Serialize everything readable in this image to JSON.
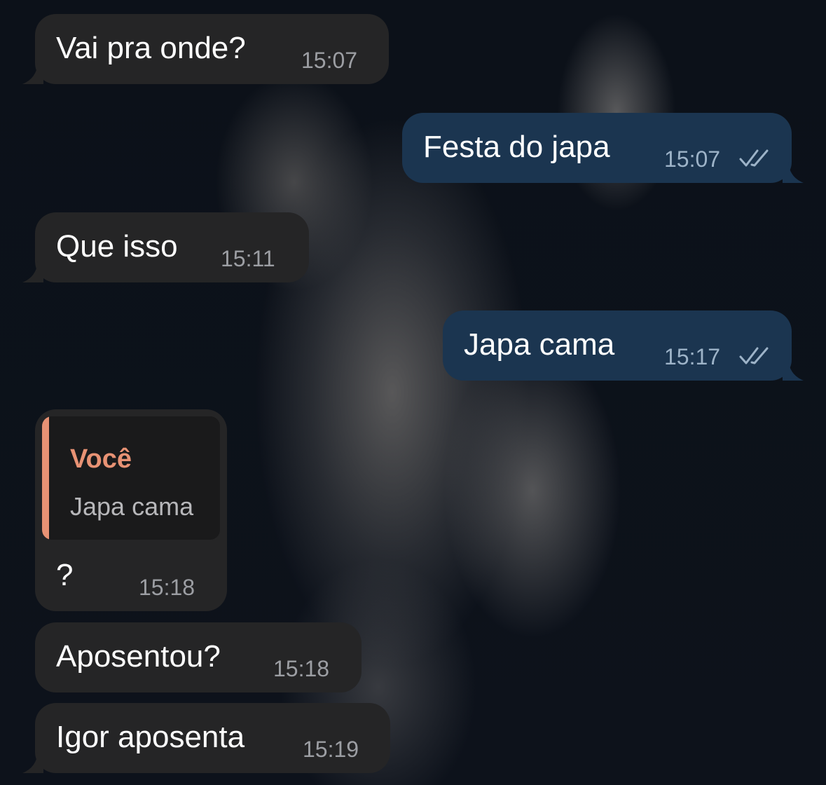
{
  "chat": {
    "messages": [
      {
        "direction": "incoming",
        "text": "Vai pra onde?",
        "time": "15:07"
      },
      {
        "direction": "outgoing",
        "text": "Festa do japa",
        "time": "15:07",
        "status": "read"
      },
      {
        "direction": "incoming",
        "text": "Que isso",
        "time": "15:11"
      },
      {
        "direction": "outgoing",
        "text": "Japa cama",
        "time": "15:17",
        "status": "read"
      },
      {
        "direction": "incoming",
        "text": "?",
        "time": "15:18",
        "reply_to": {
          "author": "Você",
          "text": "Japa cama"
        }
      },
      {
        "direction": "incoming",
        "text": "Aposentou?",
        "time": "15:18"
      },
      {
        "direction": "incoming",
        "text": "Igor aposenta",
        "time": "15:19"
      }
    ]
  },
  "colors": {
    "incoming_bubble": "#252526",
    "outgoing_bubble": "#1b3550",
    "reply_accent": "#e89274"
  },
  "icons": {
    "read_status": "double-check-icon"
  }
}
